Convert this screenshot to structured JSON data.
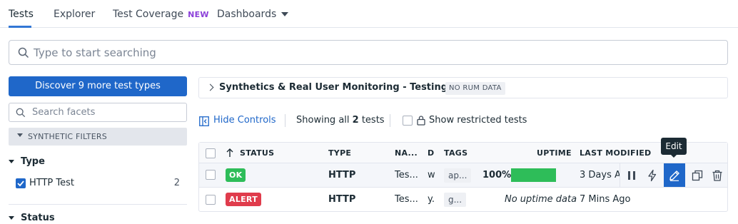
{
  "nav": {
    "tabs": [
      {
        "label": "Tests"
      },
      {
        "label": "Explorer"
      },
      {
        "label": "Test Coverage",
        "badge": "NEW"
      },
      {
        "label": "Dashboards"
      }
    ]
  },
  "search": {
    "placeholder": "Type to start searching"
  },
  "sidebar": {
    "discover_label": "Discover 9 more test types",
    "facet_search_placeholder": "Search facets",
    "filters_header": "SYNTHETIC FILTERS",
    "type_header": "Type",
    "type_items": [
      {
        "label": "HTTP Test",
        "count": "2",
        "checked": true
      }
    ],
    "status_header": "Status"
  },
  "coverage": {
    "title": "Synthetics & Real User Monitoring - Testing Coverage",
    "badge": "NO RUM DATA"
  },
  "controls": {
    "hide_controls": "Hide Controls",
    "showing_prefix": "Showing all ",
    "showing_count": "2",
    "showing_suffix": " tests",
    "restricted_label": "Show restricted tests"
  },
  "table": {
    "headers": {
      "status": "STATUS",
      "type": "TYPE",
      "name": "NA...",
      "d": "D",
      "tags": "TAGS",
      "uptime": "UPTIME",
      "last_modified": "LAST MODIFIED"
    },
    "rows": [
      {
        "status": "OK",
        "status_color": "#2ebd59",
        "type": "HTTP",
        "name": "Tes...",
        "d": "w",
        "tags": "ap...",
        "uptime": "100%",
        "uptime_fraction": 1.0,
        "last_modified": "3 Days A"
      },
      {
        "status": "ALERT",
        "status_color": "#e03c4c",
        "type": "HTTP",
        "name": "Tes...",
        "d": "y.",
        "tags": "g...",
        "uptime": "No uptime data",
        "last_modified": "7 Mins Ago"
      }
    ],
    "tooltip": "Edit"
  },
  "colors": {
    "accent": "#1f67c9",
    "ok": "#2ebd59",
    "alert": "#e03c4c",
    "new_badge": "#8b3fd9"
  }
}
